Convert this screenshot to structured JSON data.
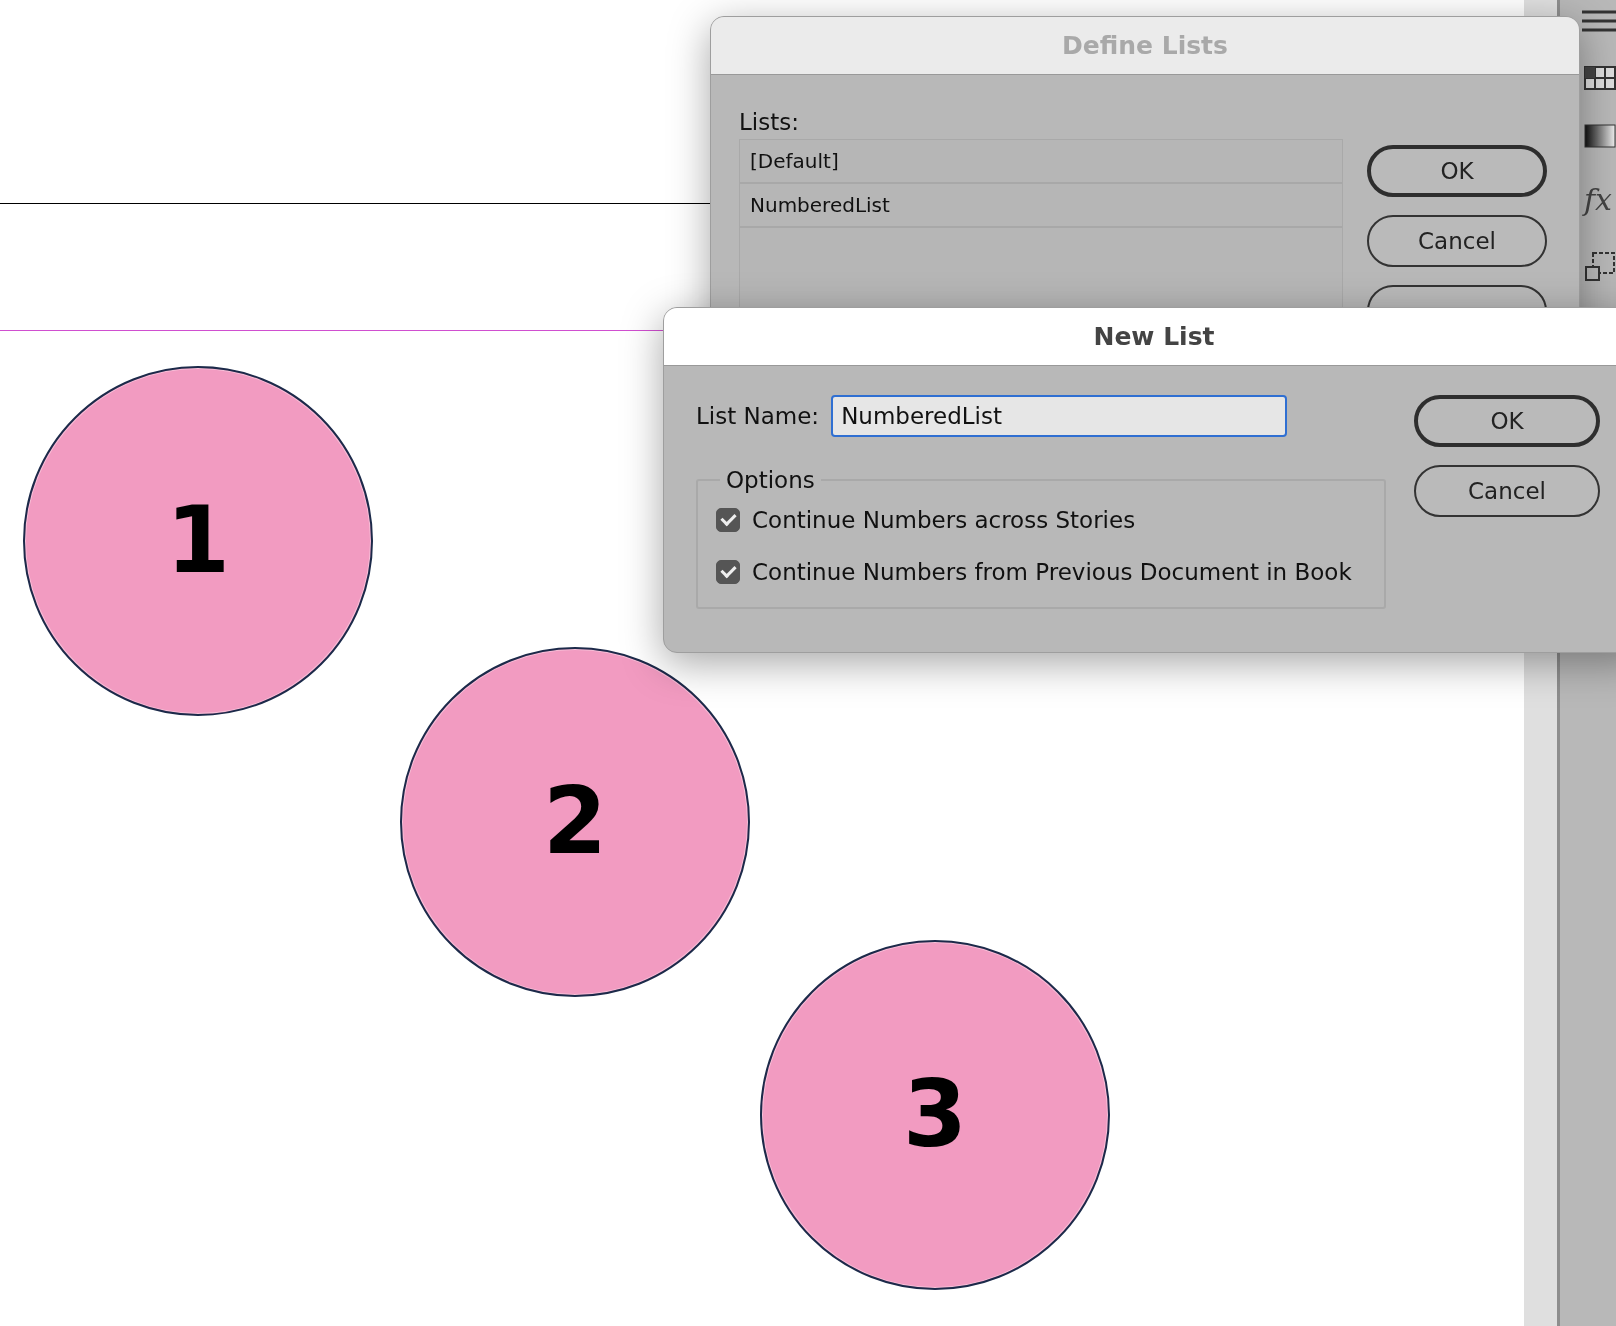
{
  "canvas": {
    "circles": [
      {
        "label": "1"
      },
      {
        "label": "2"
      },
      {
        "label": "3"
      }
    ]
  },
  "side_panel": {
    "fx_label": "fx"
  },
  "define_lists": {
    "title": "Define Lists",
    "lists_label": "Lists:",
    "lists": [
      "[Default]",
      "NumberedList"
    ],
    "buttons": [
      "OK",
      "Cancel"
    ]
  },
  "new_list": {
    "title": "New List",
    "name_label": "List Name:",
    "name_value": "NumberedList",
    "options_label": "Options",
    "options": [
      {
        "label": "Continue Numbers across Stories",
        "checked": true
      },
      {
        "label": "Continue Numbers from Previous Document in Book",
        "checked": true
      }
    ],
    "buttons": [
      "OK",
      "Cancel"
    ]
  }
}
